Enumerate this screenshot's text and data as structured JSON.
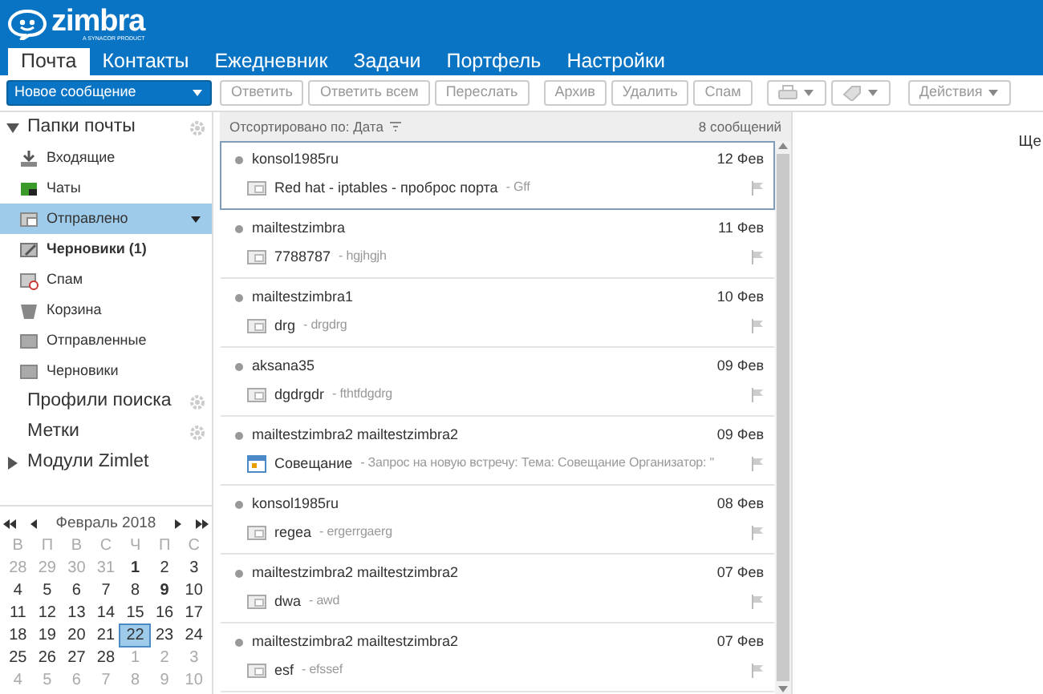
{
  "logo": {
    "name": "zimbra",
    "tagline": "A SYNACOR PRODUCT"
  },
  "app_tabs": [
    {
      "label": "Почта",
      "selected": true
    },
    {
      "label": "Контакты",
      "selected": false
    },
    {
      "label": "Ежедневник",
      "selected": false
    },
    {
      "label": "Задачи",
      "selected": false
    },
    {
      "label": "Портфель",
      "selected": false
    },
    {
      "label": "Настройки",
      "selected": false
    }
  ],
  "new_message_button": "Новое сообщение",
  "toolbar": [
    {
      "kind": "text",
      "label": "Ответить",
      "disabled": true
    },
    {
      "kind": "text",
      "label": "Ответить всем",
      "disabled": true
    },
    {
      "kind": "text",
      "label": "Переслать",
      "disabled": true
    },
    {
      "kind": "text",
      "label": "Архив",
      "disabled": true
    },
    {
      "kind": "text",
      "label": "Удалить",
      "disabled": true
    },
    {
      "kind": "text",
      "label": "Спам",
      "disabled": true
    },
    {
      "kind": "print",
      "disabled": true
    },
    {
      "kind": "tag",
      "disabled": true
    },
    {
      "kind": "menu",
      "label": "Действия",
      "disabled": true
    }
  ],
  "sidebar": {
    "sections": [
      {
        "title": "Папки почты",
        "expanded": true,
        "gear": true,
        "folders": [
          {
            "label": "Входящие",
            "kind": "inbox",
            "selected": false,
            "bold": false
          },
          {
            "label": "Чаты",
            "kind": "chat",
            "selected": false,
            "bold": false
          },
          {
            "label": "Отправлено",
            "kind": "sent",
            "selected": true,
            "bold": false
          },
          {
            "label": "Черновики (1)",
            "kind": "drafts",
            "selected": false,
            "bold": true
          },
          {
            "label": "Спам",
            "kind": "spam",
            "selected": false,
            "bold": false
          },
          {
            "label": "Корзина",
            "kind": "trash",
            "selected": false,
            "bold": false
          },
          {
            "label": "Отправленные",
            "kind": "folder",
            "selected": false,
            "bold": false
          },
          {
            "label": "Черновики",
            "kind": "folder",
            "selected": false,
            "bold": false
          }
        ]
      },
      {
        "title": "Профили поиска",
        "gear": true
      },
      {
        "title": "Метки",
        "gear": true
      },
      {
        "title": "Модули Zimlet",
        "expanded": false,
        "gear": false
      }
    ]
  },
  "calendar": {
    "title": "Февраль 2018",
    "weekdays": [
      "В",
      "П",
      "В",
      "С",
      "Ч",
      "П",
      "С"
    ],
    "weeks": [
      [
        {
          "day": "28",
          "outside": true
        },
        {
          "day": "29",
          "outside": true
        },
        {
          "day": "30",
          "outside": true
        },
        {
          "day": "31",
          "outside": true
        },
        {
          "day": "1",
          "outside": false,
          "bold": true
        },
        {
          "day": "2",
          "outside": false
        },
        {
          "day": "3",
          "outside": false
        }
      ],
      [
        {
          "day": "4",
          "outside": false
        },
        {
          "day": "5",
          "outside": false
        },
        {
          "day": "6",
          "outside": false
        },
        {
          "day": "7",
          "outside": false
        },
        {
          "day": "8",
          "outside": false
        },
        {
          "day": "9",
          "outside": false,
          "bold": true
        },
        {
          "day": "10",
          "outside": false
        }
      ],
      [
        {
          "day": "11",
          "outside": false
        },
        {
          "day": "12",
          "outside": false
        },
        {
          "day": "13",
          "outside": false
        },
        {
          "day": "14",
          "outside": false
        },
        {
          "day": "15",
          "outside": false
        },
        {
          "day": "16",
          "outside": false
        },
        {
          "day": "17",
          "outside": false
        }
      ],
      [
        {
          "day": "18",
          "outside": false
        },
        {
          "day": "19",
          "outside": false
        },
        {
          "day": "20",
          "outside": false
        },
        {
          "day": "21",
          "outside": false
        },
        {
          "day": "22",
          "outside": false,
          "selected": true
        },
        {
          "day": "23",
          "outside": false
        },
        {
          "day": "24",
          "outside": false
        }
      ],
      [
        {
          "day": "25",
          "outside": false
        },
        {
          "day": "26",
          "outside": false
        },
        {
          "day": "27",
          "outside": false
        },
        {
          "day": "28",
          "outside": false
        },
        {
          "day": "1",
          "outside": true
        },
        {
          "day": "2",
          "outside": true
        },
        {
          "day": "3",
          "outside": true
        }
      ],
      [
        {
          "day": "4",
          "outside": true
        },
        {
          "day": "5",
          "outside": true
        },
        {
          "day": "6",
          "outside": true
        },
        {
          "day": "7",
          "outside": true
        },
        {
          "day": "8",
          "outside": true
        },
        {
          "day": "9",
          "outside": true
        },
        {
          "day": "10",
          "outside": true
        }
      ]
    ]
  },
  "message_list": {
    "sort_label": "Отсортировано по: Дата",
    "count": "8 сообщений",
    "messages": [
      {
        "sender": "konsol1985ru",
        "date": "12 Фев",
        "subject": "Red hat - iptables - проброс порта",
        "fragment": "- Gff",
        "kind": "mail",
        "selected": true
      },
      {
        "sender": "mailtestzimbra",
        "date": "11 Фев",
        "subject": "7788787",
        "fragment": "- hgjhgjh",
        "kind": "mail",
        "selected": false
      },
      {
        "sender": "mailtestzimbra1",
        "date": "10 Фев",
        "subject": "drg",
        "fragment": "- drgdrg",
        "kind": "mail",
        "selected": false
      },
      {
        "sender": "aksana35",
        "date": "09 Фев",
        "subject": "dgdrgdr",
        "fragment": "- fthtfdgdrg",
        "kind": "mail",
        "selected": false
      },
      {
        "sender": "mailtestzimbra2 mailtestzimbra2",
        "date": "09 Фев",
        "subject": "Совещание",
        "fragment": "- Запрос на новую встречу: Тема: Совещание Организатор: \"",
        "kind": "appointment",
        "selected": false
      },
      {
        "sender": "konsol1985ru",
        "date": "08 Фев",
        "subject": "regea",
        "fragment": "- ergerrgaerg",
        "kind": "mail",
        "selected": false
      },
      {
        "sender": "mailtestzimbra2 mailtestzimbra2",
        "date": "07 Фев",
        "subject": "dwa",
        "fragment": "- awd",
        "kind": "mail",
        "selected": false
      },
      {
        "sender": "mailtestzimbra2 mailtestzimbra2",
        "date": "07 Фев",
        "subject": "esf",
        "fragment": "- efssef",
        "kind": "mail",
        "selected": false
      }
    ]
  },
  "reading_pane": {
    "text": "Ще"
  }
}
